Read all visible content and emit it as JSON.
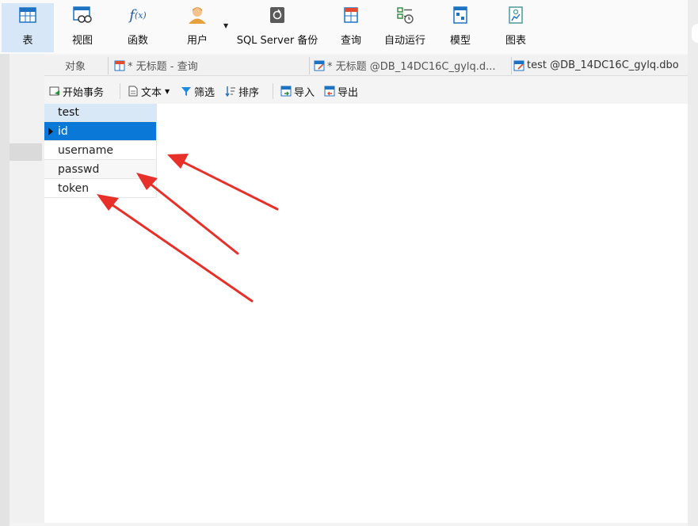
{
  "toolbar": {
    "items": [
      {
        "label": "表",
        "icon": "table-icon"
      },
      {
        "label": "视图",
        "icon": "view-icon"
      },
      {
        "label": "函数",
        "icon": "function-icon"
      },
      {
        "label": "用户",
        "icon": "user-icon"
      },
      {
        "label": "SQL Server 备份",
        "icon": "backup-icon"
      },
      {
        "label": "查询",
        "icon": "query-icon"
      },
      {
        "label": "自动运行",
        "icon": "automation-icon"
      },
      {
        "label": "模型",
        "icon": "model-icon"
      },
      {
        "label": "图表",
        "icon": "chart-icon"
      }
    ]
  },
  "tabs": [
    {
      "label": "对象"
    },
    {
      "label": "* 无标题 - 查询",
      "icon": "query-tab-icon"
    },
    {
      "label": "* 无标题 @DB_14DC16C_gylq.d...",
      "icon": "query-editor-icon"
    },
    {
      "label": "test @DB_14DC16C_gylq.dbo",
      "icon": "query-editor-icon"
    }
  ],
  "subbar": {
    "begin_transaction": "开始事务",
    "text": "文本",
    "filter": "筛选",
    "sort": "排序",
    "import": "导入",
    "export": "导出"
  },
  "grid": {
    "header": "test",
    "rows": [
      "id",
      "username",
      "passwd",
      "token"
    ],
    "selected_index": 0
  },
  "colors": {
    "selected_row": "#0a78d7",
    "header_bg": "#d9e8f6",
    "annotation_arrow": "#e8302a"
  }
}
